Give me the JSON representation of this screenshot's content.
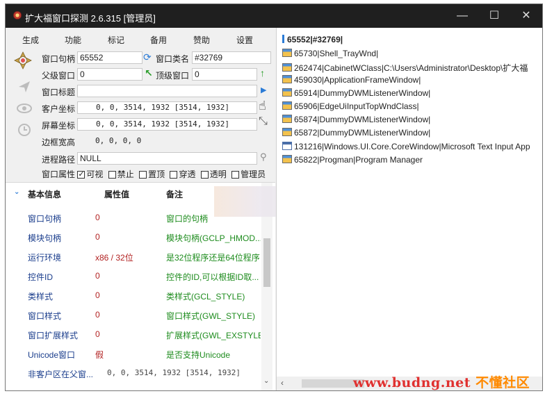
{
  "app": {
    "title": "扩大福窗口探测 2.6.315 [管理员]",
    "controls": {
      "minimize": "—",
      "maximize": "☐",
      "close": "✕"
    }
  },
  "menu": [
    "生成",
    "功能",
    "标记",
    "备用",
    "赞助",
    "设置"
  ],
  "fields": {
    "hwnd_label": "窗口句柄",
    "hwnd": "65552",
    "class_label": "窗口类名",
    "class": "#32769",
    "parent_label": "父级窗口",
    "parent": "0",
    "top_label": "顶级窗口",
    "top": "0",
    "title_label": "窗口标题",
    "title": "",
    "client_label": "客户坐标",
    "client": "0,    0,  3514,   1932 [3514, 1932]",
    "screen_label": "屏幕坐标",
    "screen": "0,    0,  3514,   1932 [3514, 1932]",
    "border_label": "边框宽高",
    "border": "0,    0,     0,      0",
    "path_label": "进程路径",
    "path": "NULL"
  },
  "attrs": {
    "label": "窗口属性",
    "options": [
      {
        "label": "可视",
        "checked": true
      },
      {
        "label": "禁止",
        "checked": false
      },
      {
        "label": "置顶",
        "checked": false
      },
      {
        "label": "穿透",
        "checked": false
      },
      {
        "label": "透明",
        "checked": false
      },
      {
        "label": "管理员",
        "checked": false
      }
    ]
  },
  "grid": {
    "headers": {
      "name": "基本信息",
      "value": "属性值",
      "note": "备注"
    },
    "rows": [
      {
        "name": "窗口句柄",
        "value": "0",
        "note": "窗口的句柄"
      },
      {
        "name": "模块句柄",
        "value": "0",
        "note": "模块句柄(GCLP_HMOD..."
      },
      {
        "name": "运行环境",
        "value": "x86 / 32位",
        "note": "是32位程序还是64位程序"
      },
      {
        "name": "控件ID",
        "value": "0",
        "note": "控件的ID,可以根据ID取..."
      },
      {
        "name": "类样式",
        "value": "0",
        "note": "类样式(GCL_STYLE)"
      },
      {
        "name": "窗口样式",
        "value": "0",
        "note": "窗口样式(GWL_STYLE)"
      },
      {
        "name": "窗口扩展样式",
        "value": "0",
        "note": "扩展样式(GWL_EXSTYLE)"
      },
      {
        "name": "Unicode窗口",
        "value": "假",
        "note": "是否支持Unicode"
      },
      {
        "name": "非客户区在父窗...",
        "value": "0,    0,  3514,   1932 [3514, 1932]",
        "note": ""
      }
    ]
  },
  "tree": {
    "root": "65552|#32769|",
    "items": [
      {
        "text": "65730|Shell_TrayWnd|",
        "icon": "window-icon"
      },
      {
        "text": "262474|CabinetWClass|C:\\Users\\Administrator\\Desktop\\扩大福",
        "icon": "window-icon"
      },
      {
        "text": "459030|ApplicationFrameWindow|",
        "icon": "window-icon"
      },
      {
        "text": "65914|DummyDWMListenerWindow|",
        "icon": "window-icon"
      },
      {
        "text": "65906|EdgeUiInputTopWndClass|",
        "icon": "window-icon"
      },
      {
        "text": "65874|DummyDWMListenerWindow|",
        "icon": "window-icon"
      },
      {
        "text": "65872|DummyDWMListenerWindow|",
        "icon": "window-icon"
      },
      {
        "text": "131216|Windows.UI.Core.CoreWindow|Microsoft Text Input App",
        "icon": "plain-window-icon"
      },
      {
        "text": "65822|Progman|Program Manager",
        "icon": "window-icon"
      }
    ]
  },
  "watermark": {
    "part1": "www.budng.net",
    "part2": " 不懂社区"
  }
}
